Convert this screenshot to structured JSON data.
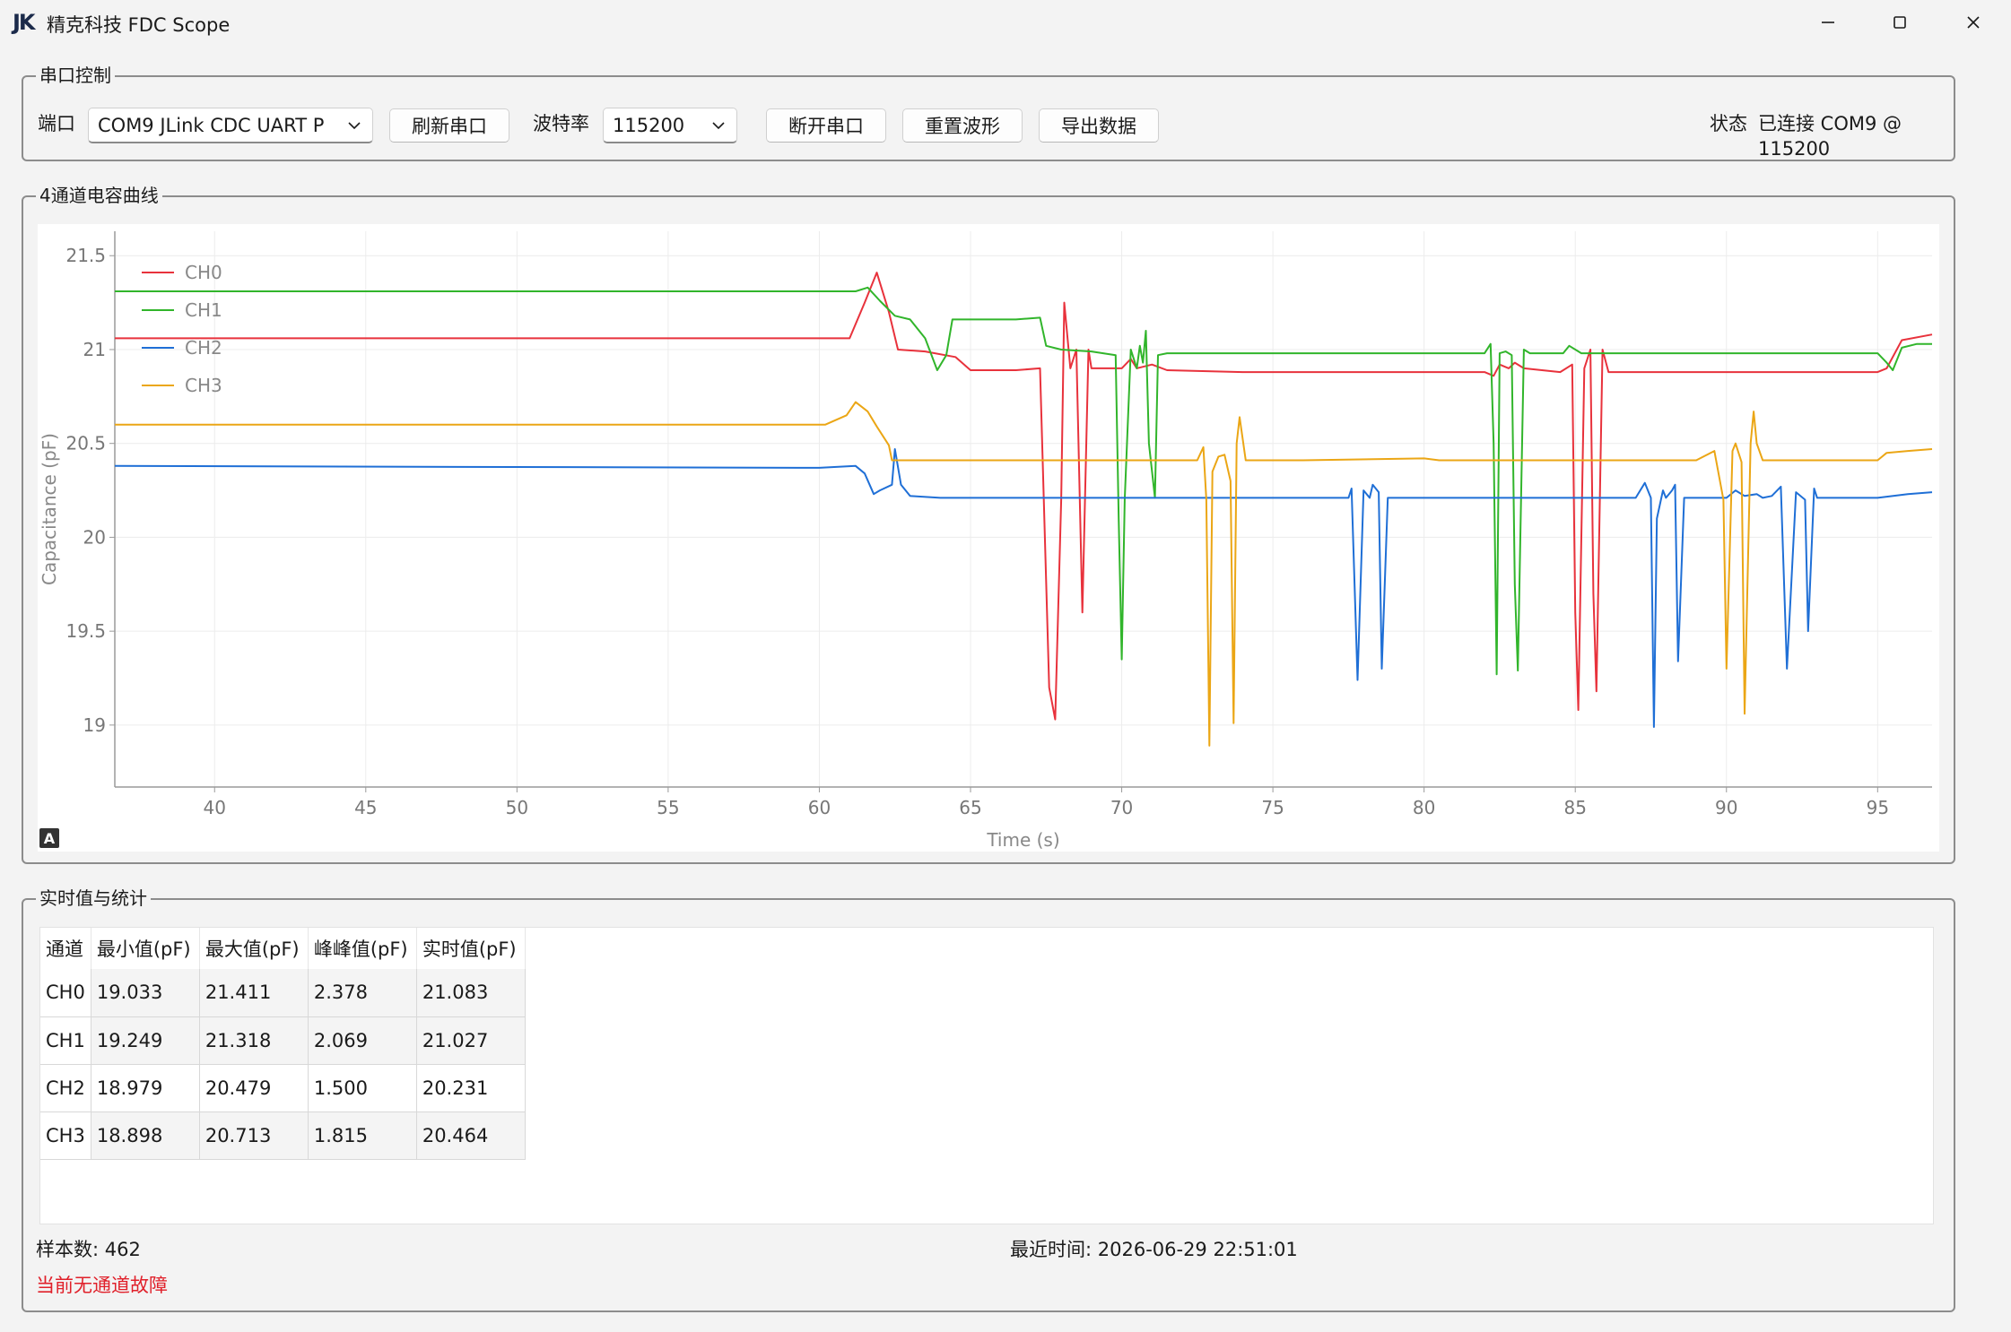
{
  "window": {
    "logo": "JK",
    "title": "精克科技 FDC Scope"
  },
  "serial": {
    "group_title": "串口控制",
    "port_label": "端口",
    "port_value": "COM9  JLink CDC UART P",
    "refresh_label": "刷新串口",
    "baud_label": "波特率",
    "baud_value": "115200",
    "disconnect_label": "断开串口",
    "reset_label": "重置波形",
    "export_label": "导出数据",
    "status_label": "状态",
    "status_value": "已连接 COM9 @ 115200"
  },
  "chart_group_title": "4通道电容曲线",
  "chart_auto_icon": "A",
  "chart_data": {
    "type": "line",
    "title": "",
    "xlabel": "Time (s)",
    "ylabel": "Capacitance (pF)",
    "xlim": [
      36.7,
      96.8
    ],
    "ylim": [
      18.67,
      21.63
    ],
    "xticks": [
      40,
      45,
      50,
      55,
      60,
      65,
      70,
      75,
      80,
      85,
      90,
      95
    ],
    "xtick_labels": [
      "40",
      "45",
      "50",
      "55",
      "60",
      "65",
      "70",
      "75",
      "80",
      "85",
      "90",
      "95"
    ],
    "yticks": [
      19,
      19.5,
      20,
      20.5,
      21,
      21.5
    ],
    "ytick_labels": [
      "19",
      "19.5",
      "20",
      "20.5",
      "21",
      "21.5"
    ],
    "grid": true,
    "legend_position": "top-left",
    "series": [
      {
        "name": "CH0",
        "color": "#e8323c",
        "points": [
          [
            36.7,
            21.06
          ],
          [
            61.0,
            21.06
          ],
          [
            61.5,
            21.25
          ],
          [
            61.9,
            21.41
          ],
          [
            62.3,
            21.2
          ],
          [
            62.6,
            21.0
          ],
          [
            63.5,
            20.99
          ],
          [
            64.5,
            20.96
          ],
          [
            65.0,
            20.89
          ],
          [
            66.5,
            20.89
          ],
          [
            67.3,
            20.9
          ],
          [
            67.6,
            19.2
          ],
          [
            67.8,
            19.03
          ],
          [
            68.0,
            20.2
          ],
          [
            68.1,
            21.25
          ],
          [
            68.3,
            20.9
          ],
          [
            68.5,
            21.0
          ],
          [
            68.7,
            19.6
          ],
          [
            68.9,
            21.0
          ],
          [
            69.0,
            20.9
          ],
          [
            70.0,
            20.9
          ],
          [
            70.3,
            20.95
          ],
          [
            70.5,
            20.9
          ],
          [
            71.0,
            20.92
          ],
          [
            71.5,
            20.89
          ],
          [
            74.0,
            20.88
          ],
          [
            82.0,
            20.88
          ],
          [
            82.3,
            20.86
          ],
          [
            82.5,
            20.92
          ],
          [
            82.8,
            20.9
          ],
          [
            83.0,
            20.93
          ],
          [
            83.3,
            20.9
          ],
          [
            84.5,
            20.88
          ],
          [
            84.9,
            20.92
          ],
          [
            85.0,
            19.6
          ],
          [
            85.1,
            19.08
          ],
          [
            85.3,
            20.9
          ],
          [
            85.5,
            21.0
          ],
          [
            85.6,
            19.7
          ],
          [
            85.7,
            19.18
          ],
          [
            85.9,
            21.0
          ],
          [
            86.1,
            20.88
          ],
          [
            95.0,
            20.88
          ],
          [
            95.3,
            20.9
          ],
          [
            95.8,
            21.05
          ],
          [
            96.8,
            21.08
          ]
        ]
      },
      {
        "name": "CH1",
        "color": "#31b52b",
        "points": [
          [
            36.7,
            21.31
          ],
          [
            60.5,
            21.31
          ],
          [
            61.2,
            21.31
          ],
          [
            61.6,
            21.33
          ],
          [
            62.0,
            21.26
          ],
          [
            62.5,
            21.18
          ],
          [
            63.0,
            21.16
          ],
          [
            63.5,
            21.06
          ],
          [
            63.9,
            20.89
          ],
          [
            64.2,
            20.97
          ],
          [
            64.4,
            21.16
          ],
          [
            65.5,
            21.16
          ],
          [
            66.5,
            21.16
          ],
          [
            67.3,
            21.17
          ],
          [
            67.5,
            21.02
          ],
          [
            68.0,
            21.0
          ],
          [
            69.0,
            20.99
          ],
          [
            69.8,
            20.97
          ],
          [
            69.9,
            20.1
          ],
          [
            70.0,
            19.35
          ],
          [
            70.1,
            20.2
          ],
          [
            70.3,
            21.0
          ],
          [
            70.5,
            20.9
          ],
          [
            70.6,
            21.02
          ],
          [
            70.7,
            20.93
          ],
          [
            70.8,
            21.1
          ],
          [
            70.9,
            20.5
          ],
          [
            71.1,
            20.21
          ],
          [
            71.2,
            20.97
          ],
          [
            71.5,
            20.98
          ],
          [
            74.5,
            20.98
          ],
          [
            80.0,
            20.98
          ],
          [
            82.0,
            20.98
          ],
          [
            82.2,
            21.03
          ],
          [
            82.3,
            20.5
          ],
          [
            82.4,
            19.27
          ],
          [
            82.5,
            20.98
          ],
          [
            82.7,
            20.99
          ],
          [
            82.9,
            20.97
          ],
          [
            83.0,
            19.75
          ],
          [
            83.1,
            19.29
          ],
          [
            83.3,
            21.0
          ],
          [
            83.5,
            20.98
          ],
          [
            84.6,
            20.98
          ],
          [
            84.8,
            21.02
          ],
          [
            85.2,
            20.98
          ],
          [
            86.0,
            20.98
          ],
          [
            95.0,
            20.98
          ],
          [
            95.3,
            20.93
          ],
          [
            95.5,
            20.89
          ],
          [
            95.8,
            21.01
          ],
          [
            96.3,
            21.03
          ],
          [
            96.8,
            21.03
          ]
        ]
      },
      {
        "name": "CH2",
        "color": "#1f6fd6",
        "points": [
          [
            36.7,
            20.38
          ],
          [
            60.0,
            20.37
          ],
          [
            61.2,
            20.38
          ],
          [
            61.5,
            20.34
          ],
          [
            61.8,
            20.23
          ],
          [
            62.0,
            20.25
          ],
          [
            62.4,
            20.28
          ],
          [
            62.5,
            20.47
          ],
          [
            62.7,
            20.28
          ],
          [
            63.0,
            20.22
          ],
          [
            64.0,
            20.21
          ],
          [
            67.0,
            20.21
          ],
          [
            74.0,
            20.21
          ],
          [
            77.5,
            20.21
          ],
          [
            77.6,
            20.26
          ],
          [
            77.8,
            19.24
          ],
          [
            78.0,
            20.25
          ],
          [
            78.2,
            20.21
          ],
          [
            78.3,
            20.28
          ],
          [
            78.5,
            20.24
          ],
          [
            78.6,
            19.3
          ],
          [
            78.8,
            20.21
          ],
          [
            79.5,
            20.21
          ],
          [
            86.5,
            20.21
          ],
          [
            87.0,
            20.21
          ],
          [
            87.3,
            20.29
          ],
          [
            87.5,
            20.21
          ],
          [
            87.6,
            18.99
          ],
          [
            87.7,
            20.1
          ],
          [
            87.9,
            20.25
          ],
          [
            88.0,
            20.21
          ],
          [
            88.2,
            20.25
          ],
          [
            88.3,
            20.28
          ],
          [
            88.4,
            19.34
          ],
          [
            88.6,
            20.21
          ],
          [
            90.0,
            20.21
          ],
          [
            90.3,
            20.25
          ],
          [
            90.6,
            20.22
          ],
          [
            91.0,
            20.23
          ],
          [
            91.2,
            20.21
          ],
          [
            91.5,
            20.22
          ],
          [
            91.8,
            20.27
          ],
          [
            92.0,
            19.3
          ],
          [
            92.3,
            20.24
          ],
          [
            92.6,
            20.2
          ],
          [
            92.7,
            19.5
          ],
          [
            92.9,
            20.26
          ],
          [
            93.0,
            20.21
          ],
          [
            95.0,
            20.21
          ],
          [
            96.0,
            20.23
          ],
          [
            96.8,
            20.24
          ]
        ]
      },
      {
        "name": "CH3",
        "color": "#eba615",
        "points": [
          [
            36.7,
            20.6
          ],
          [
            60.2,
            20.6
          ],
          [
            60.9,
            20.65
          ],
          [
            61.2,
            20.72
          ],
          [
            61.6,
            20.67
          ],
          [
            61.9,
            20.59
          ],
          [
            62.3,
            20.49
          ],
          [
            62.4,
            20.41
          ],
          [
            63.0,
            20.41
          ],
          [
            66.0,
            20.41
          ],
          [
            69.0,
            20.41
          ],
          [
            71.0,
            20.41
          ],
          [
            72.5,
            20.41
          ],
          [
            72.7,
            20.48
          ],
          [
            72.8,
            20.2
          ],
          [
            72.9,
            18.89
          ],
          [
            73.0,
            20.35
          ],
          [
            73.2,
            20.43
          ],
          [
            73.4,
            20.44
          ],
          [
            73.6,
            20.3
          ],
          [
            73.7,
            19.01
          ],
          [
            73.8,
            20.5
          ],
          [
            73.9,
            20.64
          ],
          [
            74.1,
            20.41
          ],
          [
            76.0,
            20.41
          ],
          [
            80.0,
            20.42
          ],
          [
            80.5,
            20.41
          ],
          [
            89.0,
            20.41
          ],
          [
            89.6,
            20.46
          ],
          [
            89.9,
            20.2
          ],
          [
            90.0,
            19.3
          ],
          [
            90.2,
            20.46
          ],
          [
            90.3,
            20.5
          ],
          [
            90.5,
            20.4
          ],
          [
            90.6,
            19.06
          ],
          [
            90.8,
            20.5
          ],
          [
            90.9,
            20.67
          ],
          [
            91.0,
            20.5
          ],
          [
            91.2,
            20.41
          ],
          [
            92.0,
            20.41
          ],
          [
            95.0,
            20.41
          ],
          [
            95.3,
            20.45
          ],
          [
            96.0,
            20.46
          ],
          [
            96.8,
            20.47
          ]
        ]
      }
    ]
  },
  "stats": {
    "group_title": "实时值与统计",
    "headers": [
      "通道",
      "最小值(pF)",
      "最大值(pF)",
      "峰峰值(pF)",
      "实时值(pF)"
    ],
    "rows": [
      [
        "CH0",
        "19.033",
        "21.411",
        "2.378",
        "21.083"
      ],
      [
        "CH1",
        "19.249",
        "21.318",
        "2.069",
        "21.027"
      ],
      [
        "CH2",
        "18.979",
        "20.479",
        "1.500",
        "20.231"
      ],
      [
        "CH3",
        "18.898",
        "20.713",
        "1.815",
        "20.464"
      ]
    ],
    "samples": "样本数: 462",
    "last_time": "最近时间: 2026-06-29 22:51:01",
    "fault": "当前无通道故障",
    "fault_color": "#e0202a"
  }
}
